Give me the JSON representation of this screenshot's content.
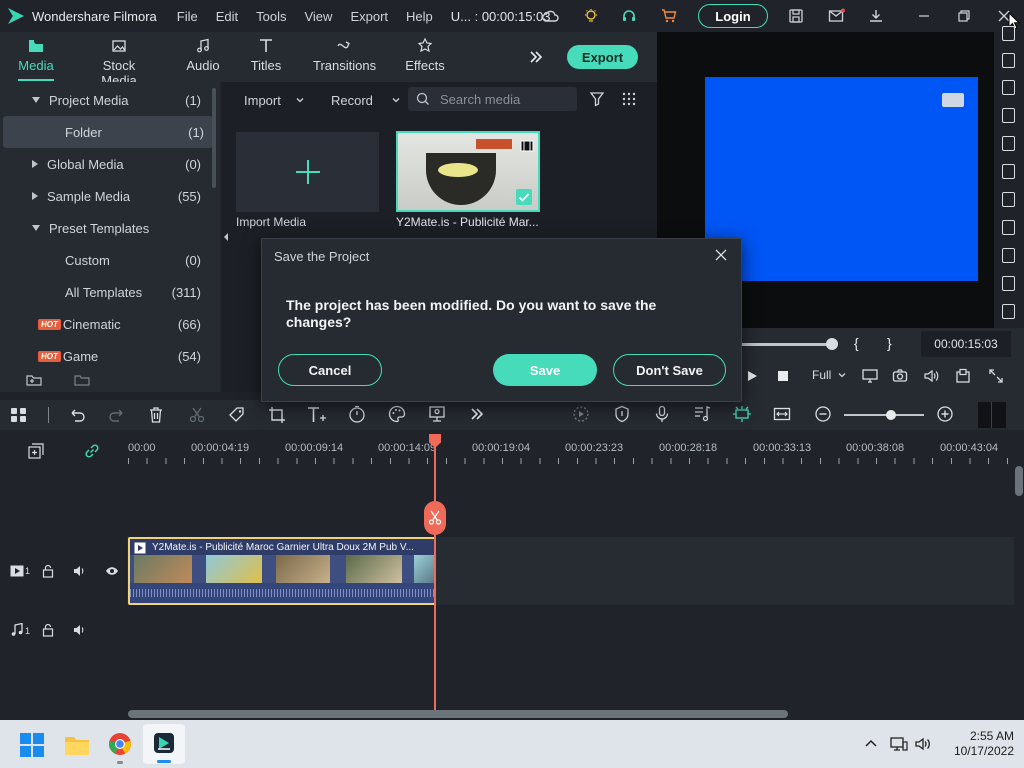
{
  "app": {
    "name": "Wondershare Filmora",
    "project_time": "U... : 00:00:15:03"
  },
  "menu": [
    "File",
    "Edit",
    "Tools",
    "View",
    "Export",
    "Help"
  ],
  "titlebar": {
    "login_label": "Login"
  },
  "tabs": [
    {
      "label": "Media",
      "icon": "folder-icon",
      "active": true
    },
    {
      "label": "Stock Media",
      "icon": "image-icon"
    },
    {
      "label": "Audio",
      "icon": "music-icon"
    },
    {
      "label": "Titles",
      "icon": "text-icon"
    },
    {
      "label": "Transitions",
      "icon": "transition-icon"
    },
    {
      "label": "Effects",
      "icon": "effects-icon"
    }
  ],
  "export_label": "Export",
  "tree": [
    {
      "label": "Project Media",
      "count": "(1)",
      "expanded": true
    },
    {
      "label": "Folder",
      "count": "(1)",
      "selected": true
    },
    {
      "label": "Global Media",
      "count": "(0)"
    },
    {
      "label": "Sample Media",
      "count": "(55)"
    },
    {
      "label": "Preset Templates",
      "count": "",
      "expanded": true
    },
    {
      "label": "Custom",
      "count": "(0)"
    },
    {
      "label": "All Templates",
      "count": "(311)"
    },
    {
      "label": "Cinematic",
      "count": "(66)",
      "hot": "HOT"
    },
    {
      "label": "Game",
      "count": "(54)",
      "hot": "HOT"
    }
  ],
  "media_toolbar": {
    "import_label": "Import",
    "record_label": "Record",
    "search_placeholder": "Search media"
  },
  "media_items": [
    {
      "label": "Import Media"
    },
    {
      "label": "Y2Mate.is - Publicité Mar..."
    }
  ],
  "preview": {
    "timecode": "00:00:15:03",
    "quality": "Full"
  },
  "ruler": [
    "00:00",
    "00:00:04:19",
    "00:00:09:14",
    "00:00:14:09",
    "00:00:19:04",
    "00:00:23:23",
    "00:00:28:18",
    "00:00:33:13",
    "00:00:38:08",
    "00:00:43:04"
  ],
  "clip": {
    "title": "Y2Mate.is - Publicité Maroc Garnier Ultra Doux 2M Pub V..."
  },
  "tracks": {
    "video_num": "1",
    "audio_num": "1"
  },
  "dialog": {
    "title": "Save the Project",
    "message": "The project has been modified. Do you want to save the changes?",
    "cancel": "Cancel",
    "save": "Save",
    "dont_save": "Don't Save"
  },
  "taskbar": {
    "time": "2:55 AM",
    "date": "10/17/2022"
  },
  "colors": {
    "accent": "#46dcbb",
    "playhead": "#f06a5a",
    "preview_blue": "#0055f5"
  }
}
